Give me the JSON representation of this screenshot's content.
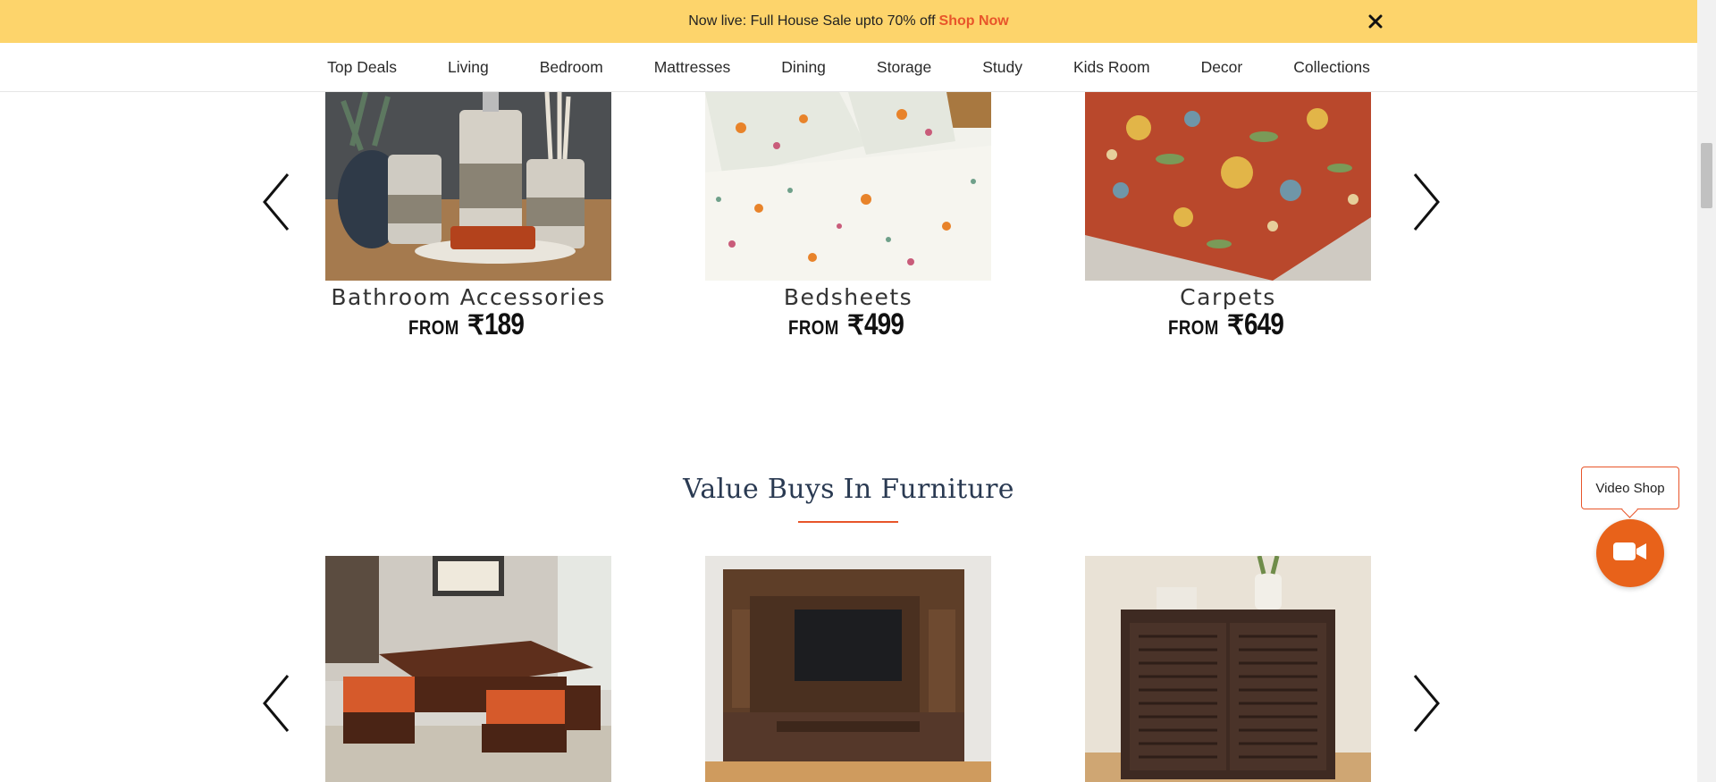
{
  "promo": {
    "text": "Now live: Full House Sale upto 70% off",
    "link": "Shop Now"
  },
  "nav": {
    "items": [
      "Top Deals",
      "Living",
      "Bedroom",
      "Mattresses",
      "Dining",
      "Storage",
      "Study",
      "Kids Room",
      "Decor",
      "Collections"
    ]
  },
  "row1": {
    "cards": [
      {
        "label": "Bathroom Accessories",
        "from": "FROM",
        "currency": "₹",
        "price": "189"
      },
      {
        "label": "Bedsheets",
        "from": "FROM",
        "currency": "₹",
        "price": "499"
      },
      {
        "label": "Carpets",
        "from": "FROM",
        "currency": "₹",
        "price": "649"
      }
    ]
  },
  "section": {
    "title": "Value Buys In Furniture"
  },
  "row2": {
    "cards": [
      {
        "image": "coffee-table-set"
      },
      {
        "image": "tv-unit"
      },
      {
        "image": "shoe-cabinet"
      }
    ]
  },
  "video_shop": {
    "label": "Video Shop",
    "icon": "video-camera-icon"
  },
  "colors": {
    "promo_bg": "#fdd46b",
    "accent": "#e8552a",
    "video_button": "#e8621a",
    "heading": "#2a3a52"
  }
}
